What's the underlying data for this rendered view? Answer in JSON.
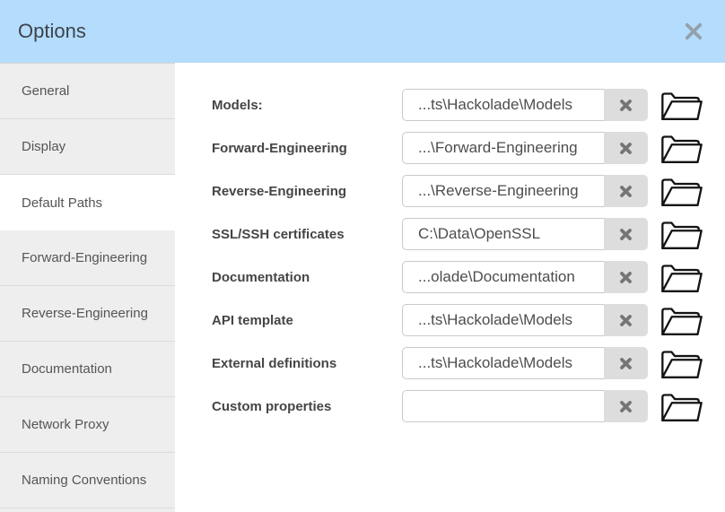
{
  "window": {
    "title": "Options"
  },
  "colors": {
    "header_bg": "#b4dcfc",
    "sidebar_bg": "#eeeeee",
    "active_tab_bg": "#ffffff",
    "clear_button_bg": "#dddddd",
    "input_border": "#c9c9c9",
    "title_text": "#3d434b",
    "label_text": "#454545"
  },
  "icons": {
    "close": "x-icon",
    "clear": "x-icon",
    "browse": "folder-icon"
  },
  "sidebar": {
    "items": [
      {
        "label": "General",
        "active": false
      },
      {
        "label": "Display",
        "active": false
      },
      {
        "label": "Default Paths",
        "active": true
      },
      {
        "label": "Forward-Engineering",
        "active": false
      },
      {
        "label": "Reverse-Engineering",
        "active": false
      },
      {
        "label": "Documentation",
        "active": false
      },
      {
        "label": "Network Proxy",
        "active": false
      },
      {
        "label": "Naming Conventions",
        "active": false
      }
    ]
  },
  "content": {
    "rows": [
      {
        "label": "Models:",
        "value": "...ts\\Hackolade\\Models"
      },
      {
        "label": "Forward-Engineering",
        "value": "...\\Forward-Engineering"
      },
      {
        "label": "Reverse-Engineering",
        "value": "...\\Reverse-Engineering"
      },
      {
        "label": "SSL/SSH certificates",
        "value": "C:\\Data\\OpenSSL"
      },
      {
        "label": "Documentation",
        "value": "...olade\\Documentation"
      },
      {
        "label": "API template",
        "value": "...ts\\Hackolade\\Models"
      },
      {
        "label": "External definitions",
        "value": "...ts\\Hackolade\\Models"
      },
      {
        "label": "Custom properties",
        "value": ""
      }
    ]
  }
}
